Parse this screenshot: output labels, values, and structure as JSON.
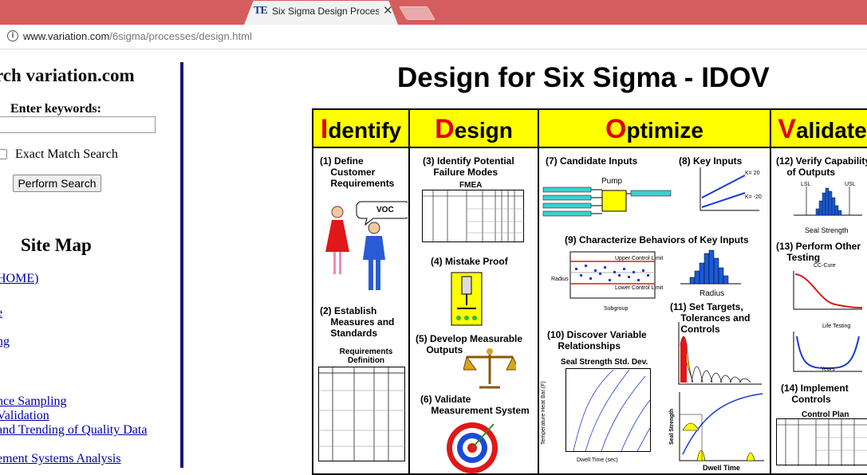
{
  "browser": {
    "tab_title": "Six Sigma Design Proces",
    "tab_logo": "TE",
    "url_host": "www.variation.com",
    "url_path": "/6sigma/processes/design.html"
  },
  "sidebar": {
    "search_title": "rch variation.com",
    "keywords_label": "Enter keywords:",
    "exact_match_label": "Exact Match Search",
    "search_button": "Perform Search",
    "sitemap_title": "Site Map",
    "links": [
      "HOME)",
      "e",
      "ng",
      "nce Sampling",
      " Validation",
      "and Trending of Quality Data",
      "ement Systems Analysis"
    ]
  },
  "main": {
    "title": "Design for Six Sigma - IDOV",
    "phases": [
      {
        "cap": "I",
        "rest": "dentify"
      },
      {
        "cap": "D",
        "rest": "esign"
      },
      {
        "cap": "O",
        "rest": "ptimize"
      },
      {
        "cap": "V",
        "rest": "alidate"
      }
    ],
    "steps": {
      "s1": "(1) Define\n    Customer\n    Requirements",
      "s2": "(2) Establish\n    Measures and\n    Standards",
      "s3": "(3) Identify Potential\n    Failure Modes",
      "s4": "(4) Mistake Proof",
      "s5": "(5) Develop Measurable\n    Outputs",
      "s6": "(6) Validate\n    Measurement System",
      "s7": "(7) Candidate Inputs",
      "s8": "(8) Key Inputs",
      "s9": "(9) Characterize Behaviors of Key Inputs",
      "s10": "(10) Discover Variable\n    Relationships",
      "s11": "(11) Set Targets,\n    Tolerances and\n    Controls",
      "s12": "(12) Verify Capability\n    of Outputs",
      "s13": "(13) Perform Other\n    Testing",
      "s14": "(14) Implement\n    Controls"
    },
    "figure_labels": {
      "voc": "VOC",
      "req_def": "Requirements\nDefinition",
      "fmea": "FMEA",
      "pump": "Pump",
      "k20": "K= 20",
      "km20": "K= -20",
      "radius": "Radius",
      "subgroup": "Subgroup",
      "ucl": "Upper Control Limit",
      "lcl": "Lower Control Limit",
      "seal_std": "Seal Strength Std. Dev.",
      "dwell": "Dwell Time (sec)",
      "temp": "Temperature Heat Bar (F)",
      "seal_strength": "Seal Strength",
      "seal_strength_axis": "Seal Strength",
      "dwell_time": "Dwell Time",
      "lsl": "LSL",
      "usl": "USL",
      "ccure": "CC-Cure",
      "life_testing": "Life Testing",
      "years": "Years",
      "control_plan": "Control Plan"
    }
  }
}
